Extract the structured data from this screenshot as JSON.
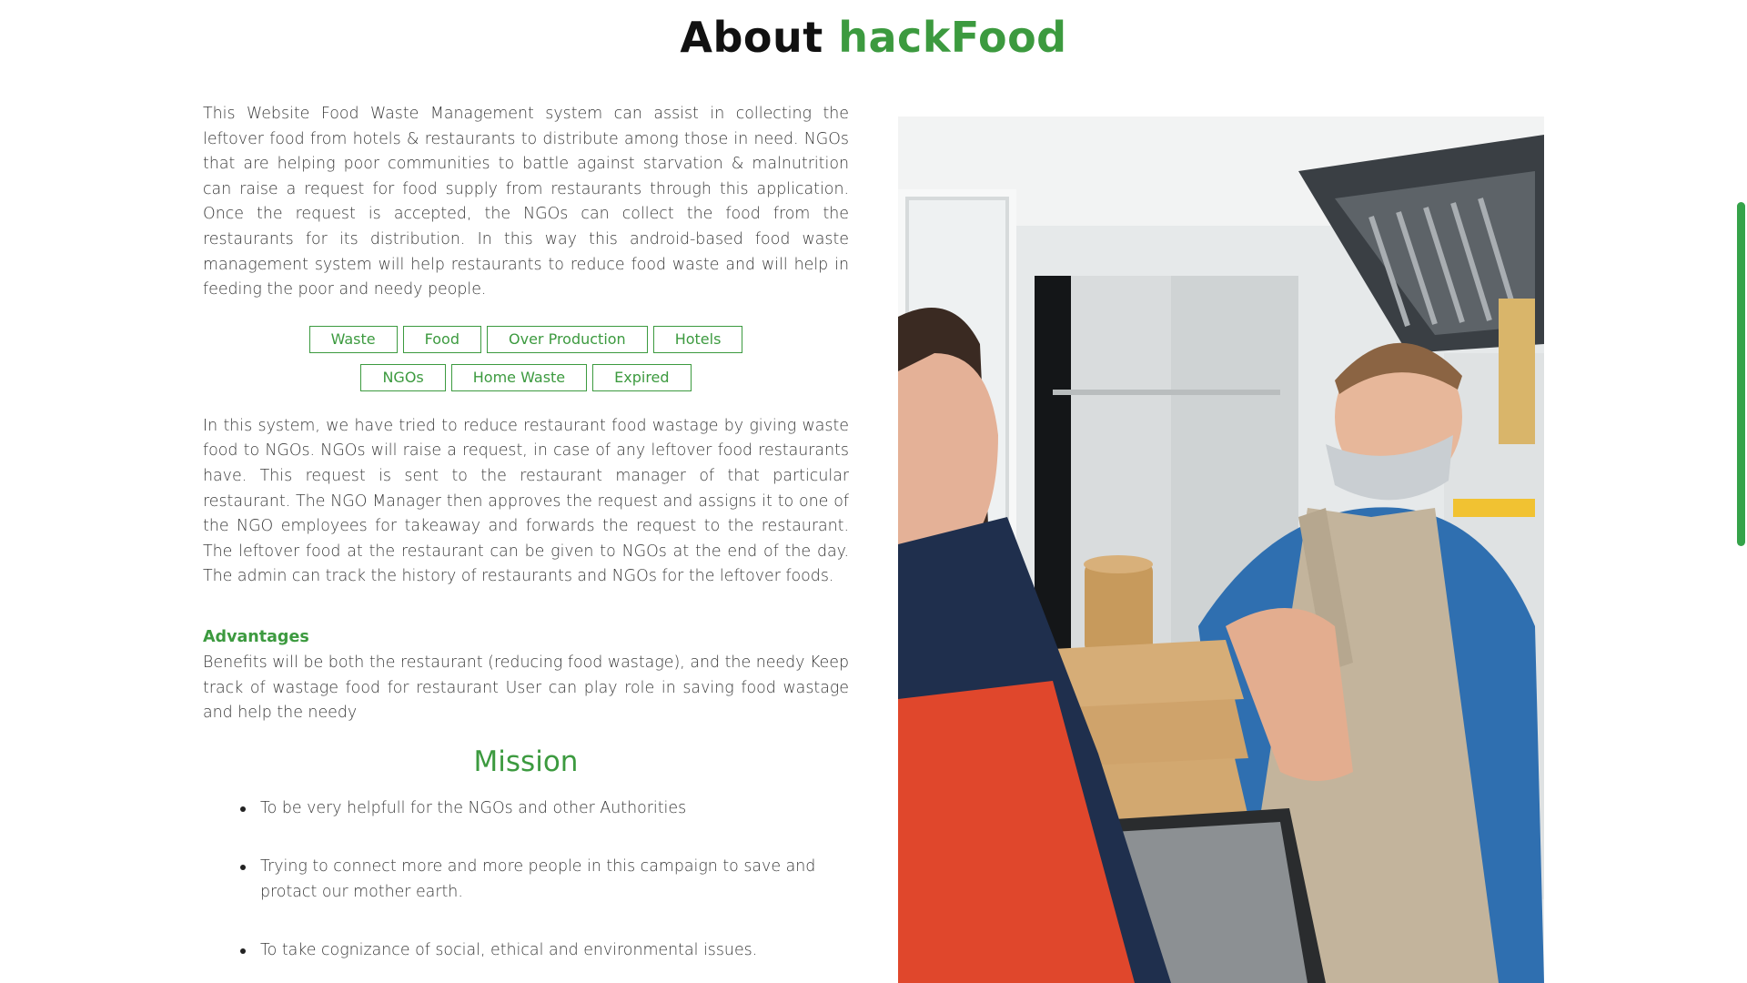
{
  "header": {
    "title_prefix": "About",
    "title_accent": "hackFood"
  },
  "about": {
    "paragraph1": "This Website Food Waste Management system can assist in collecting the leftover food from hotels & restaurants to distribute among those in need. NGOs that are helping poor communities to battle against starvation & malnutrition can raise a request for food supply from restaurants through this application. Once the request is accepted, the NGOs can collect the food from the restaurants for its distribution. In this way this android-based food waste management system will help restaurants to reduce food waste and will help in feeding the poor and needy people.",
    "tags_row1": [
      "Waste",
      "Food",
      "Over Production",
      "Hotels"
    ],
    "tags_row2": [
      "NGOs",
      "Home Waste",
      "Expired"
    ],
    "paragraph2": "In this system, we have tried to reduce restaurant food wastage by giving waste food to NGOs. NGOs will raise a request, in case of any leftover food restaurants have. This request is sent to the restaurant manager of that particular restaurant. The NGO Manager then approves the request and assigns it to one of the NGO employees for takeaway and forwards the request to the restaurant. The leftover food at the restaurant can be given to NGOs at the end of the day. The admin can track the history of restaurants and NGOs for the leftover foods."
  },
  "advantages": {
    "heading": "Advantages",
    "text": "Benefits will be both the restaurant (reducing food wastage), and the needy Keep track of wastage food for restaurant User can play role in saving food wastage and help the needy"
  },
  "mission": {
    "heading": "Mission",
    "items": [
      "To be very helpfull for the NGOs and other Authorities",
      "Trying to connect more and more people in this campaign to save and protact our mother earth.",
      "To take cognizance of social, ethical and environmental issues."
    ]
  },
  "colors": {
    "accent": "#3c9a3f",
    "scrollbar": "#35a34a",
    "text": "#3a3a3a"
  }
}
